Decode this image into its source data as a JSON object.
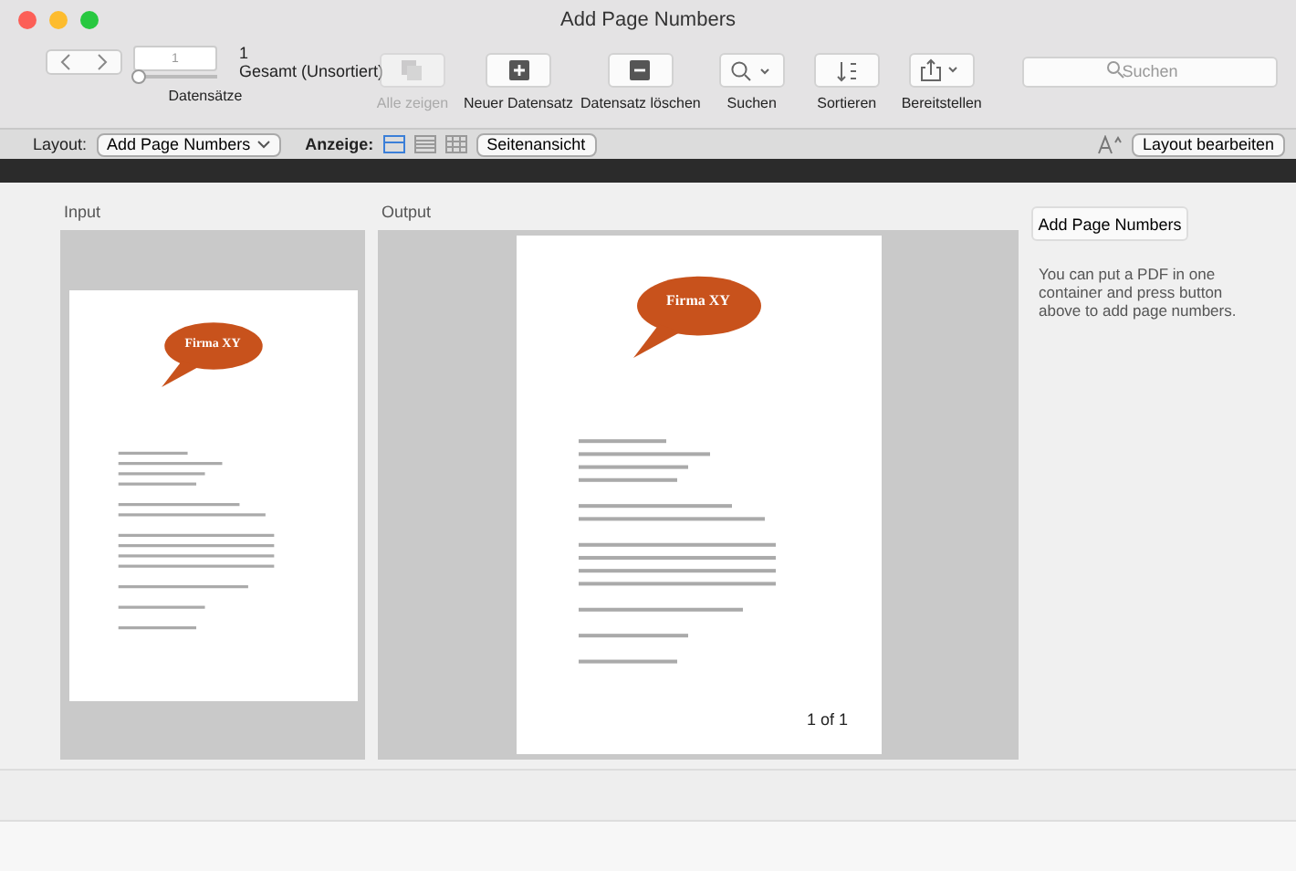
{
  "window": {
    "title": "Add Page Numbers"
  },
  "toolbar": {
    "record_field": {
      "value": "1",
      "level": 0
    },
    "found_count": "1",
    "sort_state": "Gesamt (Unsortiert)",
    "records_label": "Datensätze",
    "buttons": [
      {
        "kind": "showall",
        "label": "Alle zeigen",
        "disabled": true
      },
      {
        "kind": "add",
        "label": "Neuer Datensatz",
        "disabled": false
      },
      {
        "kind": "delete",
        "label": "Datensatz löschen",
        "disabled": false
      },
      {
        "kind": "search",
        "label": "Suchen",
        "disabled": false
      },
      {
        "kind": "sort",
        "label": "Sortieren",
        "disabled": false
      },
      {
        "kind": "share",
        "label": "Bereitstellen",
        "disabled": false
      }
    ],
    "search": {
      "placeholder": "Suchen"
    }
  },
  "layout_bar": {
    "layout_label": "Layout:",
    "layout_value": "Add Page Numbers",
    "view_label": "Anzeige:",
    "views": [
      {
        "kind": "form",
        "selected": true
      },
      {
        "kind": "list",
        "selected": false
      },
      {
        "kind": "table",
        "selected": false
      }
    ],
    "preview_button": "Seitenansicht",
    "edit_button": "Layout bearbeiten"
  },
  "content": {
    "input": {
      "label": "Input",
      "logo": "Firma XY"
    },
    "output": {
      "label": "Output",
      "logo": "Firma XY",
      "page_number": "1 of 1"
    },
    "action_button": "Add Page Numbers",
    "help_text": "You can put a PDF in one container and press button above to add page numbers."
  }
}
